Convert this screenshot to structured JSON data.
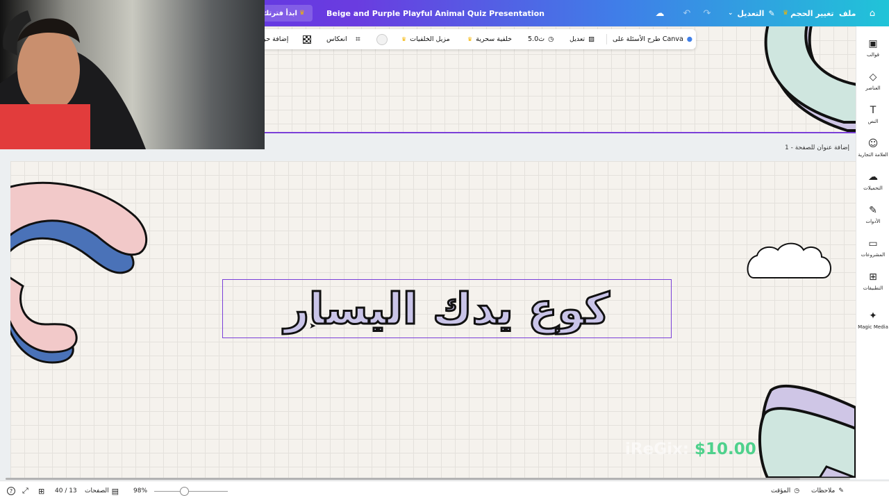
{
  "topbar": {
    "home_label": "⌂",
    "file_label": "ملف",
    "resize_label": "تغيير الحجم",
    "edit_label": "التعديل",
    "doc_title": "Beige and Purple Playful Animal Quiz Presentation",
    "start_trial_label": "ابدأ فترتك الت"
  },
  "context_toolbar": {
    "ask_canva": "طرح الأسئلة على Canva",
    "edit": "تعديل",
    "duration": "5.0ث",
    "magic_bg": "خلفية سحرية",
    "bg_remover": "مزيل الخلفيات",
    "flip": "انعكاس",
    "add_text": "إضافة حر"
  },
  "sidebar": {
    "items": [
      {
        "icon": "templates-icon",
        "label": "قوالب"
      },
      {
        "icon": "elements-icon",
        "label": "العناصر"
      },
      {
        "icon": "text-icon",
        "label": "النص"
      },
      {
        "icon": "brand-icon",
        "label": "العلامة التجارية"
      },
      {
        "icon": "uploads-icon",
        "label": "التحميلات"
      },
      {
        "icon": "tools-icon",
        "label": "الأدوات"
      },
      {
        "icon": "projects-icon",
        "label": "المشروعات"
      },
      {
        "icon": "apps-icon",
        "label": "التطبيقات"
      },
      {
        "icon": "magic-media-icon",
        "label": "Magic Media"
      }
    ]
  },
  "canvas": {
    "page_title_label": "1 - إضافة عنوان للصفحة",
    "headline": "كوع يدك اليسار",
    "watermark_name": "iReGix: ",
    "watermark_price": "$10.00"
  },
  "bottombar": {
    "notes": "ملاحظات",
    "timer": "المؤقت",
    "zoom": "98%",
    "pages_label": "الصفحات",
    "page_count": "40 / 13"
  },
  "colors": {
    "accent": "#7a3fd8",
    "pink": "#f2c9c9",
    "blue": "#4a72b8",
    "mint": "#cfe6df",
    "lavender": "#cfc6e6",
    "price_green": "#4fd18c"
  }
}
